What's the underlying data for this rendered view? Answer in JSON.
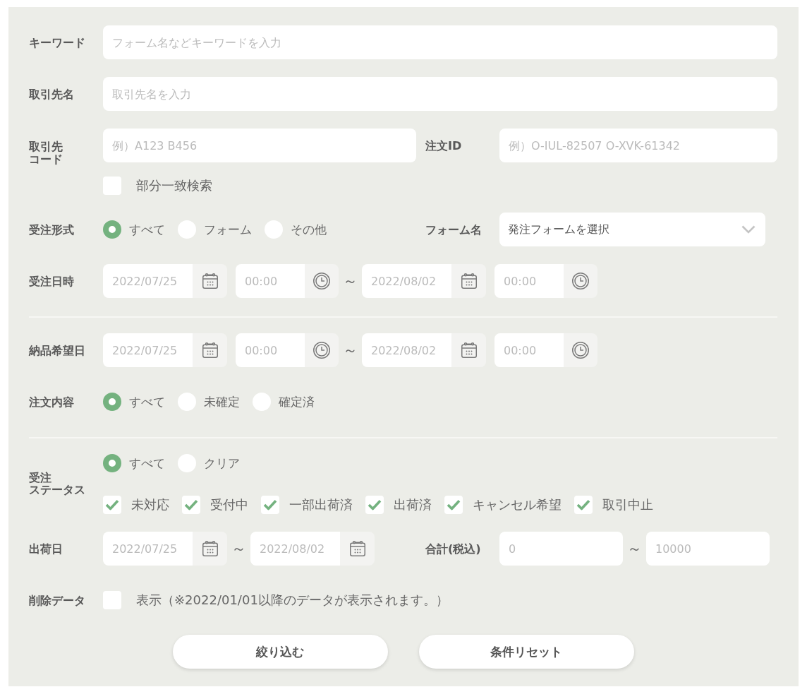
{
  "rows": [
    {
      "kind": "text",
      "label": "キーワード",
      "placeholder": "フォーム名などキーワードを入力"
    },
    {
      "kind": "text",
      "label": "取引先名",
      "placeholder": "取引先名を入力"
    },
    {
      "kind": "code",
      "label_lines": [
        "取引先",
        "コード"
      ],
      "placeholder": "例）A123 B456",
      "order_id": {
        "label": "注文ID",
        "placeholder": "例）O-IUL-82507 O-XVK-61342"
      },
      "partial_match": {
        "label": "部分一致検索",
        "checked": false
      }
    },
    {
      "kind": "radio_select",
      "label": "受注形式",
      "options": [
        {
          "label": "すべて",
          "selected": true
        },
        {
          "label": "フォーム",
          "selected": false
        },
        {
          "label": "その他",
          "selected": false
        }
      ],
      "form_name": {
        "label": "フォーム名",
        "value": "発注フォームを選択"
      }
    },
    {
      "kind": "datetime",
      "label": "受注日時",
      "from": {
        "date": {
          "placeholder": "2022/07/25"
        },
        "time": {
          "placeholder": "00:00"
        }
      },
      "separator": "～",
      "to": {
        "date": {
          "placeholder": "2022/08/02"
        },
        "time": {
          "placeholder": "00:00"
        }
      }
    },
    {
      "kind": "divider"
    },
    {
      "kind": "datetime",
      "label": "納品希望日",
      "from": {
        "date": {
          "placeholder": "2022/07/25"
        },
        "time": {
          "placeholder": "00:00"
        }
      },
      "separator": "～",
      "to": {
        "date": {
          "placeholder": "2022/08/02"
        },
        "time": {
          "placeholder": "00:00"
        }
      }
    },
    {
      "kind": "radio",
      "label": "注文内容",
      "options": [
        {
          "label": "すべて",
          "selected": true
        },
        {
          "label": "未確定",
          "selected": false
        },
        {
          "label": "確定済",
          "selected": false
        }
      ]
    },
    {
      "kind": "divider"
    },
    {
      "kind": "status",
      "label_lines": [
        "受注",
        "ステータス"
      ],
      "options": [
        {
          "label": "すべて",
          "selected": true
        },
        {
          "label": "クリア",
          "selected": false
        }
      ],
      "statuses": [
        {
          "label": "未対応",
          "checked": true
        },
        {
          "label": "受付中",
          "checked": true
        },
        {
          "label": "一部出荷済",
          "checked": true
        },
        {
          "label": "出荷済",
          "checked": true
        },
        {
          "label": "キャンセル希望",
          "checked": true
        },
        {
          "label": "取引中止",
          "checked": true
        }
      ]
    },
    {
      "kind": "date_amount",
      "label": "出荷日",
      "from": {
        "placeholder": "2022/07/25"
      },
      "separator": "～",
      "to": {
        "placeholder": "2022/08/02"
      },
      "total": {
        "label": "合計(税込)",
        "from": {
          "placeholder": "0"
        },
        "separator": "～",
        "to": {
          "placeholder": "10000"
        }
      }
    },
    {
      "kind": "checkbox",
      "label": "削除データ",
      "option": {
        "label": "表示（※2022/01/01以降のデータが表示されます。）",
        "checked": false
      }
    }
  ],
  "buttons": [
    {
      "label": "絞り込む"
    },
    {
      "label": "条件リセット"
    }
  ]
}
